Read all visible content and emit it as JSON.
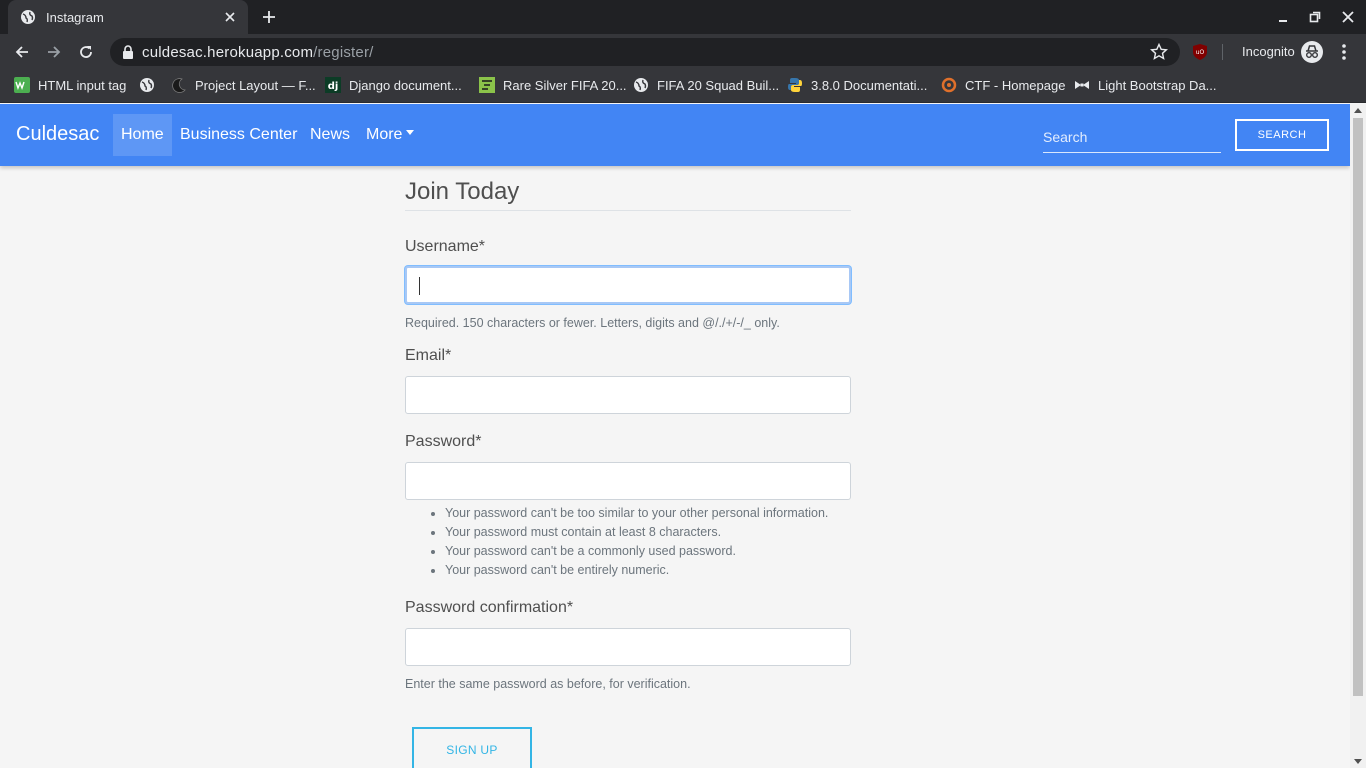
{
  "browser": {
    "tab_title": "Instagram",
    "url_host": "culdesac.herokuapp.com",
    "url_path": "/register/",
    "incognito_label": "Incognito",
    "bookmarks": [
      {
        "label": "HTML input tag",
        "icon": "w3-icon"
      },
      {
        "label": "",
        "icon": "globe-icon"
      },
      {
        "label": "Project Layout — F...",
        "icon": "moon-icon"
      },
      {
        "label": "Django document...",
        "icon": "django-icon"
      },
      {
        "label": "Rare Silver FIFA 20...",
        "icon": "futwiz-icon"
      },
      {
        "label": "FIFA 20 Squad Buil...",
        "icon": "globe-icon"
      },
      {
        "label": "3.8.0 Documentati...",
        "icon": "python-icon"
      },
      {
        "label": "CTF - Homepage",
        "icon": "ctf-icon"
      },
      {
        "label": "Light Bootstrap Da...",
        "icon": "bow-icon"
      }
    ]
  },
  "navbar": {
    "brand": "Culdesac",
    "links": [
      "Home",
      "Business Center",
      "News",
      "More"
    ],
    "search_placeholder": "Search",
    "search_button": "SEARCH",
    "color": "#4285f4"
  },
  "form": {
    "title": "Join Today",
    "username_label": "Username*",
    "username_help": "Required. 150 characters or fewer. Letters, digits and @/./+/-/_ only.",
    "email_label": "Email*",
    "password_label": "Password*",
    "password_help": [
      "Your password can't be too similar to your other personal information.",
      "Your password must contain at least 8 characters.",
      "Your password can't be a commonly used password.",
      "Your password can't be entirely numeric."
    ],
    "password_confirm_label": "Password confirmation*",
    "password_confirm_help": "Enter the same password as before, for verification.",
    "submit": "SIGN UP",
    "submit_color": "#33b5e5"
  }
}
